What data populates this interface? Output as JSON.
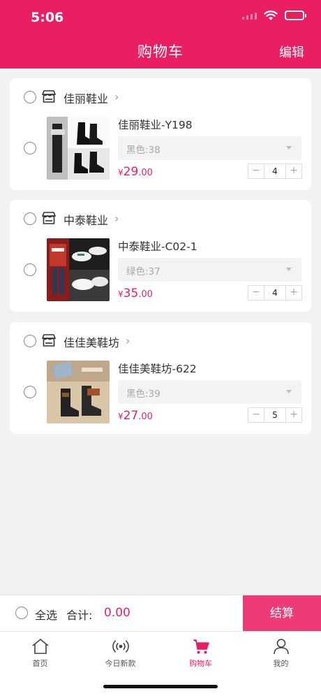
{
  "status_bar": {
    "time": "5:06"
  },
  "header": {
    "title": "购物车",
    "edit_label": "编辑"
  },
  "colors": {
    "accent": "#e91e63",
    "checkout_button": "#ec3b76"
  },
  "shops": [
    {
      "name": "佳丽鞋业",
      "product": {
        "name": "佳丽鞋业-Y198",
        "variant": "黑色:38",
        "price_symbol": "¥",
        "price_int": "29",
        "price_dec": ".00",
        "quantity": "4"
      }
    },
    {
      "name": "中泰鞋业",
      "product": {
        "name": "中泰鞋业-C02-1",
        "variant": "绿色:37",
        "price_symbol": "¥",
        "price_int": "35",
        "price_dec": ".00",
        "quantity": "4"
      }
    },
    {
      "name": "佳佳美鞋坊",
      "product": {
        "name": "佳佳美鞋坊-622",
        "variant": "黑色:39",
        "price_symbol": "¥",
        "price_int": "27",
        "price_dec": ".00",
        "quantity": "5"
      }
    }
  ],
  "stepper": {
    "minus": "−",
    "plus": "+"
  },
  "checkout": {
    "select_all_label": "全选",
    "total_label": "合计:",
    "total_value": "0.00",
    "settle_label": "结算"
  },
  "tabs": [
    {
      "label": "首页",
      "icon": "home-icon"
    },
    {
      "label": "今日新款",
      "icon": "broadcast-icon"
    },
    {
      "label": "购物车",
      "icon": "cart-icon",
      "active": true
    },
    {
      "label": "我的",
      "icon": "user-icon"
    }
  ]
}
